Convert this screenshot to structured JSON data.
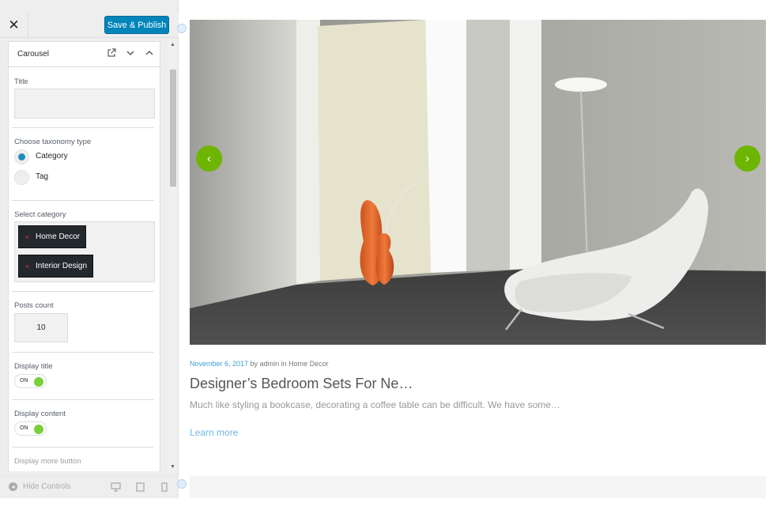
{
  "header": {
    "close_label": "✕",
    "publish_label": "Save & Publish"
  },
  "section": {
    "title": "Carousel",
    "icons": [
      "external-link-icon",
      "chevron-down-icon",
      "chevron-up-icon"
    ]
  },
  "form": {
    "title_label": "Title",
    "title_value": "",
    "taxonomy_label": "Choose taxonomy type",
    "taxonomy_options": [
      {
        "label": "Category",
        "checked": true
      },
      {
        "label": "Tag",
        "checked": false
      }
    ],
    "category_label": "Select category",
    "categories": [
      "Home Decor",
      "Interior Design"
    ],
    "chip_remove": "×",
    "posts_count_label": "Posts count",
    "posts_count_value": "10",
    "display_title_label": "Display title",
    "display_title_state": "ON",
    "display_content_label": "Display content",
    "display_content_state": "ON",
    "display_more_label": "Display more button"
  },
  "footer": {
    "hide_controls_label": "Hide Controls",
    "devices": [
      "desktop-icon",
      "tablet-icon",
      "mobile-icon"
    ]
  },
  "carousel": {
    "prev_label": "‹",
    "next_label": "›"
  },
  "post": {
    "date": "November 6, 2017",
    "by": " by ",
    "author": "admin",
    "in": " in ",
    "category": "Home Decor",
    "title": "Designer’s Bedroom Sets For Ne…",
    "excerpt": "Much like styling a bookcase, decorating a coffee table can be difficult. We have some…",
    "learn_more": "Learn more"
  },
  "colors": {
    "primary_button": "#0085ba",
    "accent_green": "#6db500",
    "link_blue": "#3aa1d8",
    "toggle_on": "#7ad03a",
    "radio_checked": "#1e8cbe"
  }
}
